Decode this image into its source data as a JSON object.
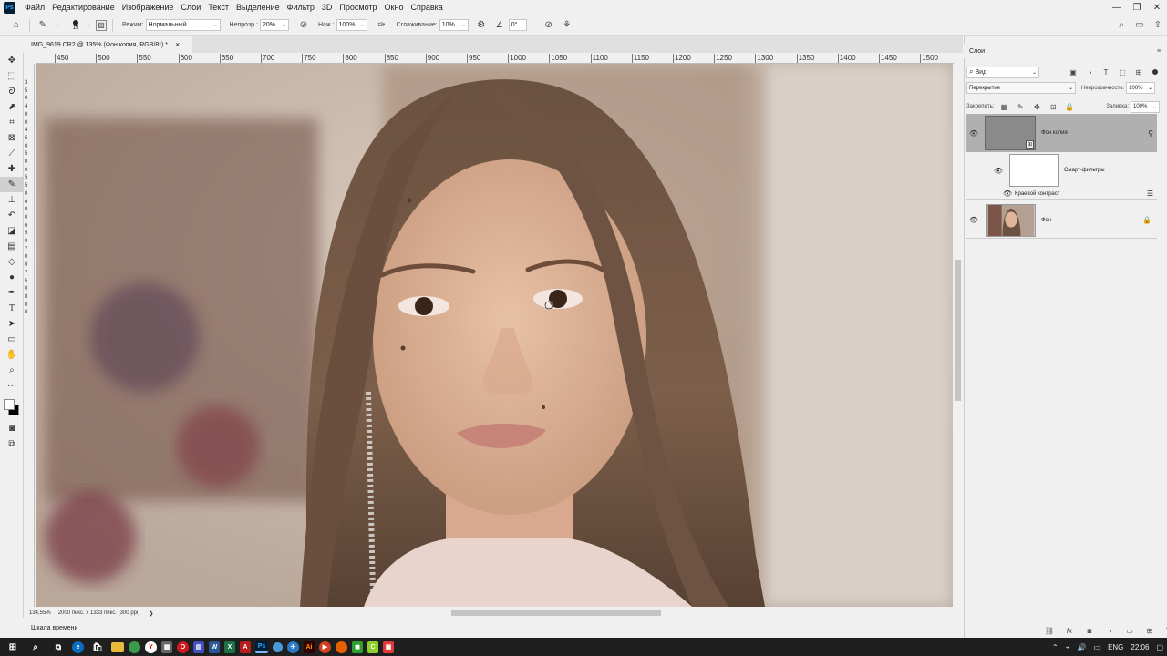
{
  "menu": {
    "items": [
      "Файл",
      "Редактирование",
      "Изображение",
      "Слои",
      "Текст",
      "Выделение",
      "Фильтр",
      "3D",
      "Просмотр",
      "Окно",
      "Справка"
    ]
  },
  "options": {
    "brush_size": "15",
    "mode_label": "Режим:",
    "mode_value": "Нормальный",
    "opacity_label": "Непрозр.:",
    "opacity_value": "20%",
    "pressure_label": "Наж.:",
    "pressure_value": "100%",
    "smoothing_label": "Сглаживание:",
    "smoothing_value": "10%",
    "angle_value": "0°"
  },
  "document": {
    "tab_title": "IMG_9619.CR2 @ 135% (Фон копия, RGB/8*) *",
    "close_glyph": "×"
  },
  "ruler": {
    "top_labels": [
      "450",
      "500",
      "550",
      "600",
      "650",
      "700",
      "750",
      "800",
      "850",
      "900",
      "950",
      "1000",
      "1050",
      "1100",
      "1150",
      "1200",
      "1250",
      "1300",
      "1350",
      "1400",
      "1450",
      "1500"
    ],
    "left_labels": [
      "3",
      "5",
      "0",
      "4",
      "0",
      "0",
      "4",
      "5",
      "0",
      "5",
      "0",
      "0",
      "5",
      "5",
      "0",
      "6",
      "0",
      "0",
      "6",
      "5",
      "0",
      "7",
      "0",
      "0",
      "7",
      "5",
      "0",
      "8",
      "0",
      "0"
    ]
  },
  "status": {
    "zoom": "134,55%",
    "size": "2000 пикс. x 1333 пикс. (300 ppi)",
    "arrow": "❯"
  },
  "timeline": {
    "label": "Шкала времени"
  },
  "layers_panel": {
    "tab": "Слои",
    "filter_kind": "Вид",
    "blend_mode": "Перекрытие",
    "opacity_label": "Непрозрачность:",
    "opacity_value": "100%",
    "lock_label": "Закрепить:",
    "fill_label": "Заливка:",
    "fill_value": "100%",
    "layers": [
      {
        "name": "Фон копия",
        "selected": true
      },
      {
        "name": "Смарт-фильтры",
        "filter": "Краевой контраст"
      },
      {
        "name": "Фон",
        "locked": true
      }
    ]
  },
  "taskbar": {
    "lang": "ENG",
    "time": "22:06"
  },
  "colors": {
    "accent": "#31a8ff",
    "panel_selected": "#a8a8a8",
    "taskbar": "#1f1f1f"
  }
}
